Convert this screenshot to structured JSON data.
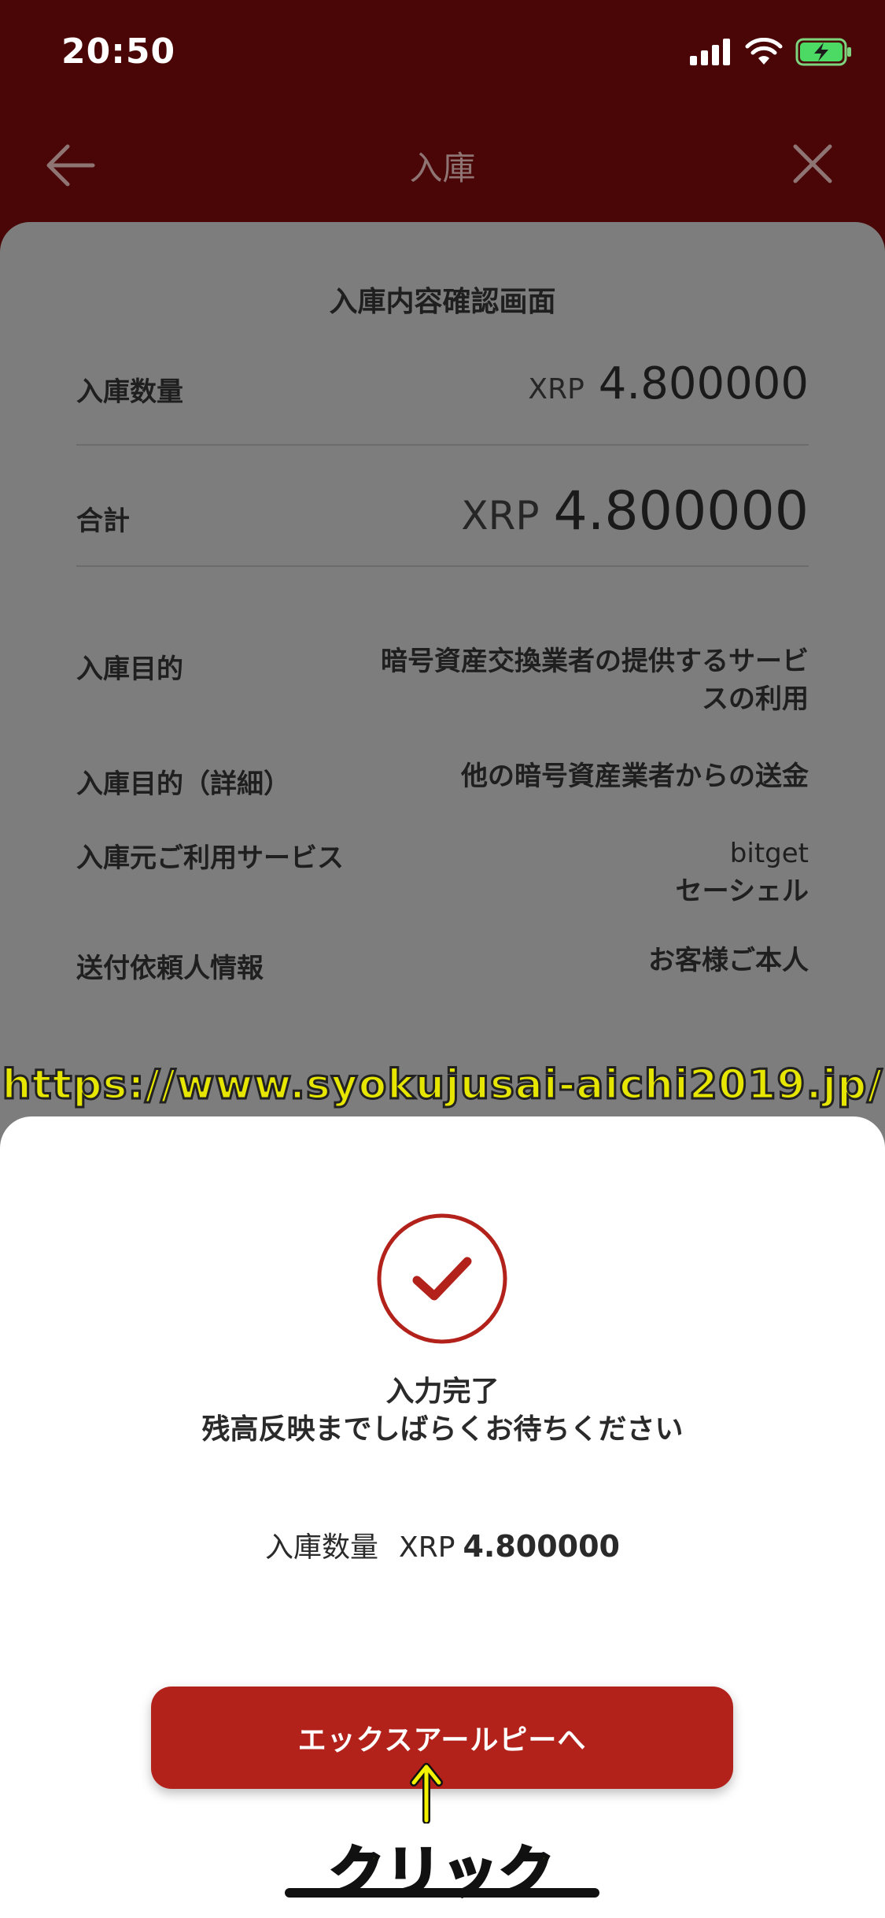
{
  "status_bar": {
    "time": "20:50",
    "signal_icon": "cellular-signal-icon",
    "wifi_icon": "wifi-icon",
    "battery_icon": "battery-charging-icon"
  },
  "nav": {
    "title": "入庫",
    "back_icon": "arrow-left-icon",
    "close_icon": "close-icon"
  },
  "confirm": {
    "title": "入庫内容確認画面",
    "quantity_label": "入庫数量",
    "quantity_unit": "XRP",
    "quantity_value": "4.800000",
    "total_label": "合計",
    "total_unit": "XRP",
    "total_value": "4.800000",
    "purpose_label": "入庫目的",
    "purpose_value_line1": "暗号資産交換業者の提供するサービ",
    "purpose_value_line2": "スの利用",
    "purpose_detail_label": "入庫目的（詳細）",
    "purpose_detail_value": "他の暗号資産業者からの送金",
    "source_service_label": "入庫元ご利用サービス",
    "source_service_value_line1": "bitget",
    "source_service_value_line2": "セーシェル",
    "requester_label": "送付依頼人情報",
    "requester_value": "お客様ご本人"
  },
  "watermark": "https://www.syokujusai-aichi2019.jp/",
  "sheet": {
    "check_icon": "check-circle-icon",
    "complete_line1": "入力完了",
    "complete_line2": "残高反映までしばらくお待ちください",
    "amount_label": "入庫数量",
    "amount_unit": "XRP",
    "amount_value": "4.800000",
    "cta_label": "エックスアールピーへ",
    "annotation_arrow_icon": "up-arrow-icon",
    "annotation_label": "クリック"
  },
  "colors": {
    "header_bg": "#4a0606",
    "dimmed_card": "#7d7d7d",
    "accent_red": "#b3221a",
    "annotation_yellow": "#f2f200"
  }
}
